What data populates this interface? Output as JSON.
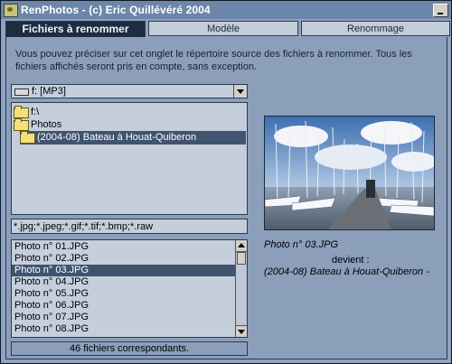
{
  "window": {
    "title": "RenPhotos - (c) Eric Quillévéré 2004"
  },
  "tabs": [
    {
      "label": "Fichiers à renommer",
      "active": true
    },
    {
      "label": "Modèle",
      "active": false
    },
    {
      "label": "Renommage",
      "active": false
    }
  ],
  "description": "Vous pouvez préciser sur cet onglet le répertoire source des fichiers à renommer. Tous les fichiers affichés seront pris en compte, sans exception.",
  "drive": {
    "label": "f: [MP3]"
  },
  "tree": [
    {
      "label": "f:\\",
      "selected": false
    },
    {
      "label": "Photos",
      "selected": false
    },
    {
      "label": "(2004-08) Bateau à Houat-Quiberon",
      "selected": true
    }
  ],
  "filter": {
    "value": "*.jpg;*.jpeg;*.gif;*.tif;*.bmp;*.raw"
  },
  "files": [
    {
      "label": "Photo n° 01.JPG",
      "selected": false
    },
    {
      "label": "Photo n° 02.JPG",
      "selected": false
    },
    {
      "label": "Photo n° 03.JPG",
      "selected": true
    },
    {
      "label": "Photo n° 04.JPG",
      "selected": false
    },
    {
      "label": "Photo n° 05.JPG",
      "selected": false
    },
    {
      "label": "Photo n° 06.JPG",
      "selected": false
    },
    {
      "label": "Photo n° 07.JPG",
      "selected": false
    },
    {
      "label": "Photo n° 08.JPG",
      "selected": false
    }
  ],
  "status": "46 fichiers correspondants.",
  "preview": {
    "filename": "Photo n° 03.JPG",
    "becomes": "devient :",
    "new_name": "(2004-08) Bateau à Houat-Quiberon -"
  },
  "colors": {
    "titlebar": "#6b86a8",
    "panel": "#8b9fbb",
    "selection": "#40546f",
    "active_tab": "#1e2c40"
  }
}
